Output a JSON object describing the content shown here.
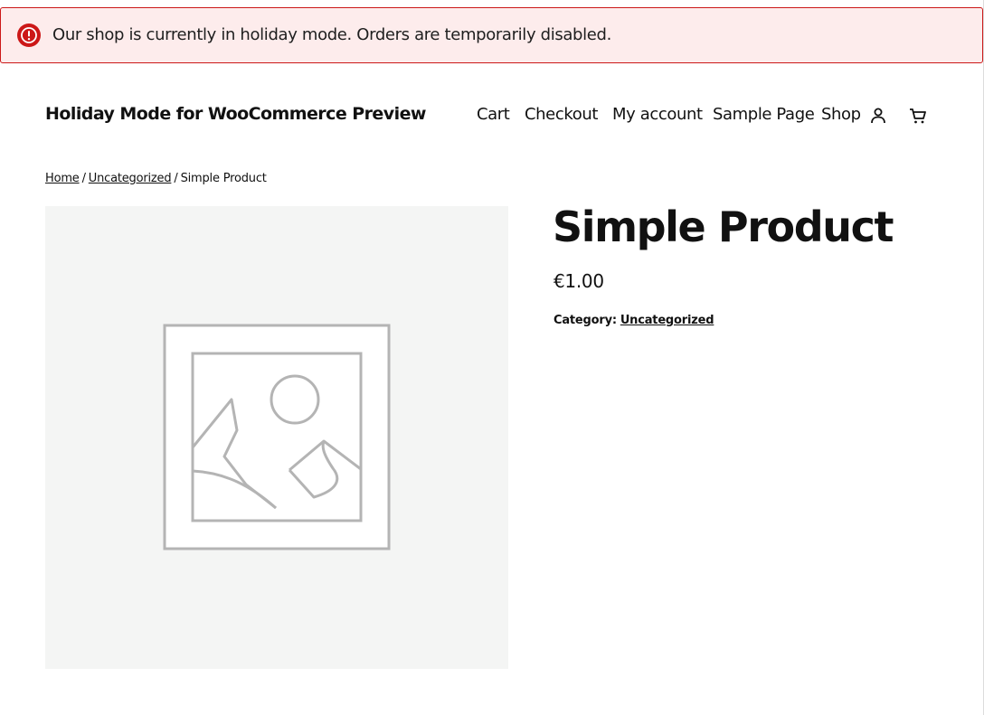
{
  "notice": {
    "text": "Our shop is currently in holiday mode. Orders are temporarily disabled.",
    "icon": "alert-circle-icon",
    "color": "#cc1818",
    "background": "#fdecec"
  },
  "header": {
    "site_title": "Holiday Mode for WooCommerce Preview",
    "nav": [
      "Cart",
      "Checkout",
      "My account",
      "Sample Page",
      "Shop"
    ],
    "account_icon": "user-icon",
    "cart_icon": "cart-icon"
  },
  "breadcrumb": {
    "items": [
      "Home",
      "Uncategorized"
    ],
    "current": "Simple Product",
    "separator": "/"
  },
  "product": {
    "image_icon": "image-placeholder-icon",
    "image_background": "#f4f5f4",
    "title": "Simple Product",
    "price": "€1.00",
    "category_label": "Category:",
    "category": "Uncategorized"
  }
}
